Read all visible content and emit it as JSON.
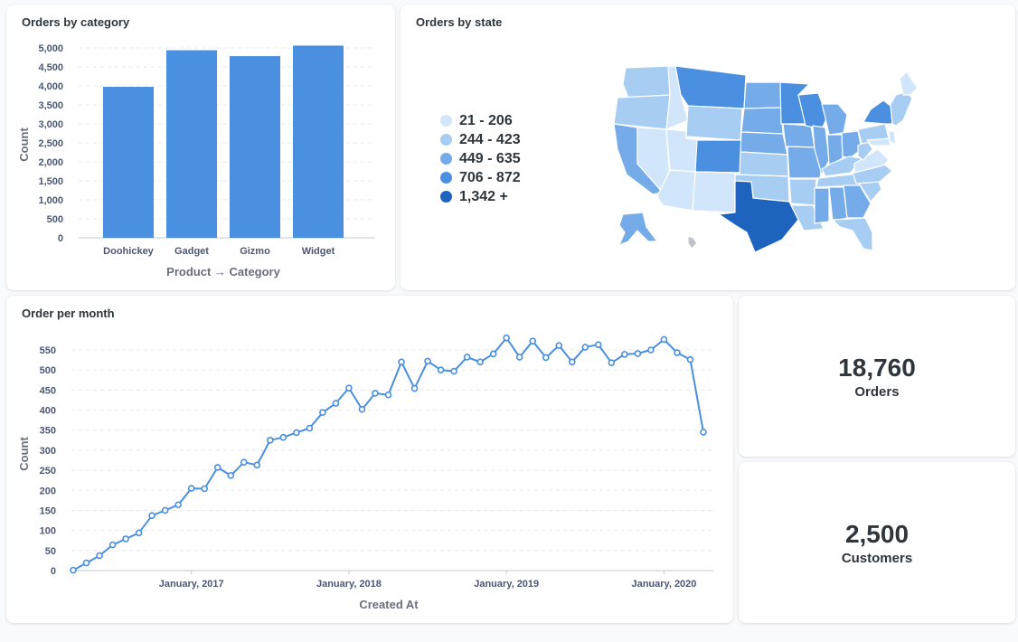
{
  "colors": {
    "bar": "#4a8fe0",
    "line": "#4a8fe0",
    "map_scale": [
      "#d2e6fb",
      "#a7cdf2",
      "#74abe8",
      "#4a8fe0",
      "#1e64be"
    ]
  },
  "cards": {
    "category": {
      "title": "Orders by category"
    },
    "state": {
      "title": "Orders by state"
    },
    "month": {
      "title": "Order per month"
    },
    "orders": {
      "value": "18,760",
      "label": "Orders"
    },
    "customers": {
      "value": "2,500",
      "label": "Customers"
    }
  },
  "map_legend": [
    {
      "label": "21 - 206"
    },
    {
      "label": "244 - 423"
    },
    {
      "label": "449 - 635"
    },
    {
      "label": "706 - 872"
    },
    {
      "label": "1,342 +"
    }
  ],
  "chart_data": [
    {
      "type": "bar",
      "title": "Orders by category",
      "xlabel": "Product → Category",
      "ylabel": "Count",
      "categories": [
        "Doohickey",
        "Gadget",
        "Gizmo",
        "Widget"
      ],
      "values": [
        3976,
        4939,
        4784,
        5061
      ],
      "ylim": [
        0,
        5000
      ],
      "yticks": [
        "0",
        "500",
        "1,000",
        "1,500",
        "2,000",
        "2,500",
        "3,000",
        "3,500",
        "4,000",
        "4,500",
        "5,000"
      ],
      "grid": true
    },
    {
      "type": "line",
      "title": "Order per month",
      "xlabel": "Created At",
      "ylabel": "Count",
      "x_start": "2016-04",
      "values": [
        1,
        19,
        37,
        64,
        79,
        94,
        137,
        150,
        164,
        205,
        204,
        257,
        237,
        270,
        263,
        325,
        332,
        344,
        355,
        394,
        417,
        455,
        402,
        442,
        438,
        520,
        454,
        522,
        500,
        497,
        532,
        520,
        540,
        580,
        532,
        572,
        531,
        561,
        520,
        557,
        563,
        518,
        539,
        541,
        550,
        576,
        543,
        526,
        345
      ],
      "ylim": [
        0,
        550
      ],
      "yticks": [
        "0",
        "50",
        "100",
        "150",
        "200",
        "250",
        "300",
        "350",
        "400",
        "450",
        "500",
        "550"
      ],
      "xticks": [
        "January, 2017",
        "January, 2018",
        "January, 2019",
        "January, 2020"
      ],
      "grid": true
    }
  ]
}
